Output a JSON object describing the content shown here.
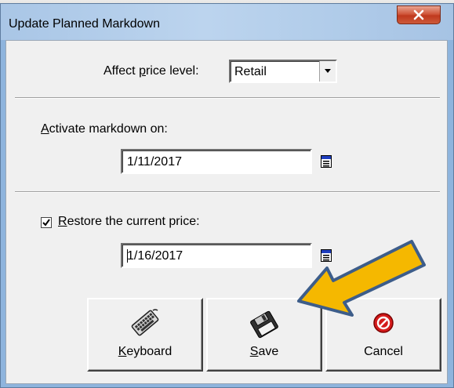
{
  "window": {
    "title": "Update Planned Markdown",
    "close_icon": "close-x-icon"
  },
  "price_level": {
    "label_pre": "Affect ",
    "label_access": "p",
    "label_post": "rice level:",
    "selected": "Retail"
  },
  "activate": {
    "label_access": "A",
    "label_post": "ctivate markdown on:",
    "date": "1/11/2017",
    "calendar_icon": "calendar-icon"
  },
  "restore": {
    "checked": true,
    "label_access": "R",
    "label_post": "estore the current price:",
    "date": "1/16/2017",
    "calendar_icon": "calendar-icon"
  },
  "buttons": {
    "keyboard": {
      "access": "K",
      "rest": "eyboard",
      "icon": "keyboard-icon"
    },
    "save": {
      "access": "S",
      "rest": "ave",
      "icon": "floppy-disk-icon"
    },
    "cancel": {
      "label": "Cancel",
      "icon": "no-entry-icon"
    }
  },
  "annotation": {
    "arrow_color": "#f5b800",
    "arrow_outline": "#3d5d8a"
  }
}
